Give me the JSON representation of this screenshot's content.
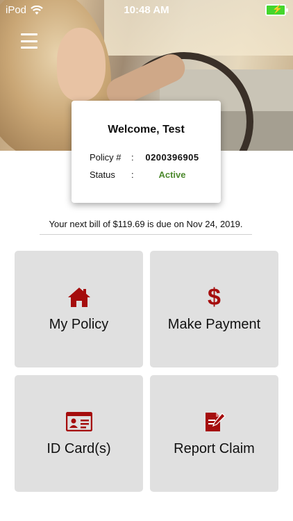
{
  "status_bar": {
    "carrier": "iPod",
    "time": "10:48 AM"
  },
  "welcome_card": {
    "greeting": "Welcome, Test",
    "policy_label": "Policy #",
    "separator": ":",
    "policy_number": "0200396905",
    "status_label": "Status",
    "status_value": "Active"
  },
  "bill_notice": "Your next bill of $119.69 is due on Nov 24, 2019.",
  "tiles": [
    {
      "label": "My Policy",
      "icon": "home-icon"
    },
    {
      "label": "Make Payment",
      "icon": "dollar-icon",
      "glyph": "$"
    },
    {
      "label": "ID Card(s)",
      "icon": "id-card-icon"
    },
    {
      "label": "Report Claim",
      "icon": "report-claim-icon"
    }
  ],
  "colors": {
    "accent": "#a50d0d",
    "status_active": "#4d8a2e",
    "tile_bg": "#e0e0e0",
    "battery": "#44d62c"
  }
}
